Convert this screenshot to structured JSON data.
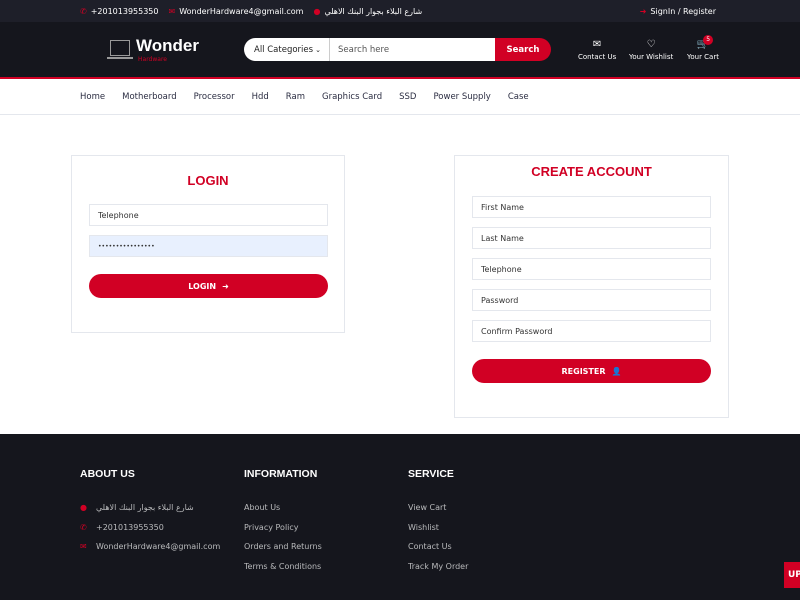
{
  "top_bar": {
    "phone": "+201013955350",
    "email": "WonderHardware4@gmail.com",
    "address": "شارع البلاء بجوار البنك الاهلي",
    "auth": "SignIn / Register"
  },
  "header": {
    "logo_name": "Wonder",
    "logo_sub": "Hardware",
    "category_select": "All Categories",
    "search_placeholder": "Search here",
    "search_button": "Search",
    "contact": "Contact Us",
    "wishlist": "Your Wishlist",
    "cart": "Your Cart",
    "cart_count": "5"
  },
  "nav": [
    "Home",
    "Motherboard",
    "Processor",
    "Hdd",
    "Ram",
    "Graphics Card",
    "SSD",
    "Power Supply",
    "Case"
  ],
  "login": {
    "title": "LOGIN",
    "telephone_placeholder": "Telephone",
    "password_value": "••••••••••••••••",
    "button": "LOGIN"
  },
  "register": {
    "title": "CREATE ACCOUNT",
    "fields": [
      "First Name",
      "Last Name",
      "Telephone",
      "Password",
      "Confirm Password"
    ],
    "button": "REGISTER"
  },
  "footer": {
    "about": {
      "title": "ABOUT US",
      "address": "شارع البلاء بجوار البنك الاهلي",
      "phone": "+201013955350",
      "email": "WonderHardware4@gmail.com"
    },
    "information": {
      "title": "INFORMATION",
      "links": [
        "About Us",
        "Privacy Policy",
        "Orders and Returns",
        "Terms & Conditions"
      ]
    },
    "service": {
      "title": "SERVICE",
      "links": [
        "View Cart",
        "Wishlist",
        "Contact Us",
        "Track My Order"
      ]
    }
  },
  "scroll_up": "UP",
  "colors": {
    "accent": "#d10024",
    "dark": "#15161d",
    "topbar": "#1e1f29"
  },
  "icons": [
    "phone-icon",
    "envelope-icon",
    "map-marker-icon",
    "user-icon",
    "heart-icon",
    "cart-icon",
    "sign-in-icon"
  ]
}
